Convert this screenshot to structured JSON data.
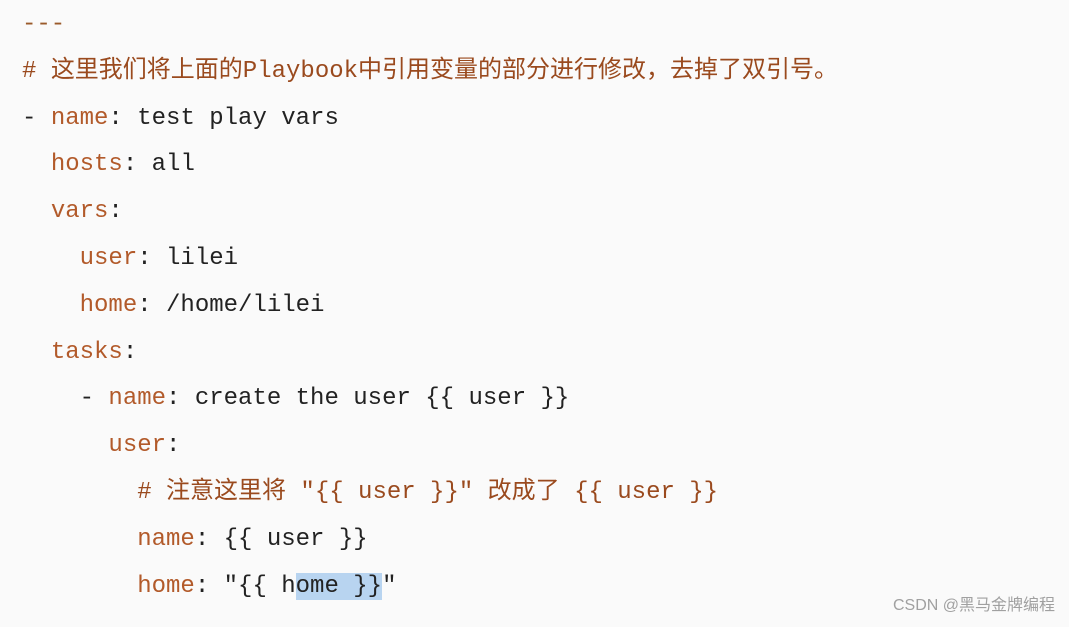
{
  "lines": {
    "l0_dashes": "---",
    "l1_hash": "# ",
    "l1_comment": "这里我们将上面的Playbook中引用变量的部分进行修改，去掉了双引号。",
    "l2_prefix": "- ",
    "l2_key": "name",
    "l2_val": " test play vars",
    "l3_ind": "  ",
    "l3_key": "hosts",
    "l3_val": " all",
    "l4_ind": "  ",
    "l4_key": "vars",
    "l5_ind": "    ",
    "l5_key": "user",
    "l5_val": " lilei",
    "l6_ind": "    ",
    "l6_key": "home",
    "l6_val": " /home/lilei",
    "l7_ind": "  ",
    "l7_key": "tasks",
    "l8_ind": "    ",
    "l8_dash": "- ",
    "l8_key": "name",
    "l8_val": " create the user {{ user }}",
    "l9_ind": "      ",
    "l9_key": "user",
    "l10_ind": "        ",
    "l10_hash": "# ",
    "l10_comment": "注意这里将 \"{{ user }}\" 改成了 {{ user }}",
    "l11_ind": "        ",
    "l11_key": "name",
    "l11_val": " {{ user }}",
    "l12_ind": "        ",
    "l12_key": "home",
    "l12_sp": " ",
    "l12_q1": "\"",
    "l12_pre": "{{ h",
    "l12_hi": "ome }}",
    "l12_q2": "\""
  },
  "watermark": "CSDN @黑马金牌编程"
}
